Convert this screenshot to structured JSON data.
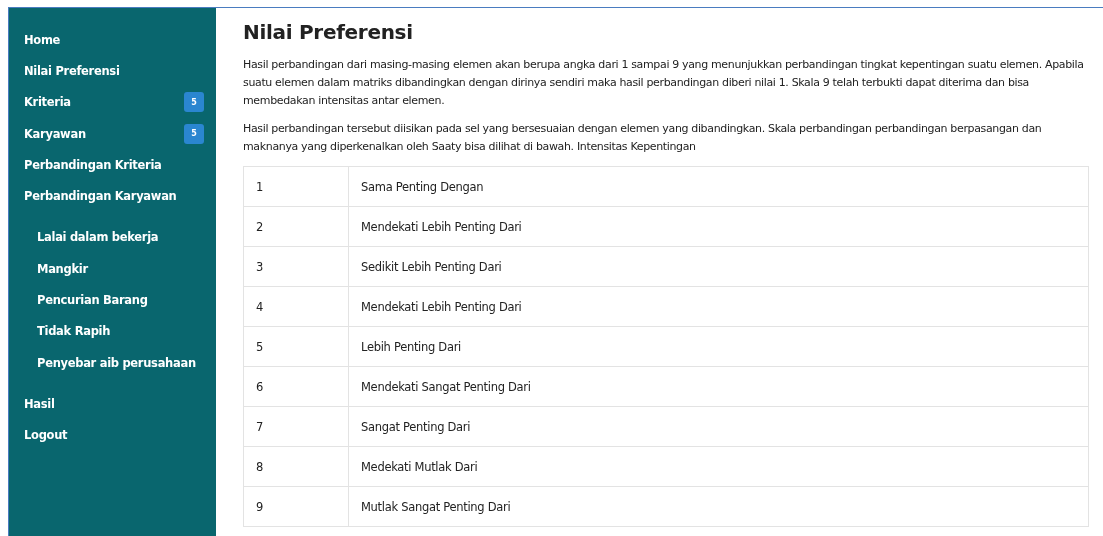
{
  "sidebar": {
    "items": [
      {
        "label": "Home"
      },
      {
        "label": "Nilai Preferensi"
      },
      {
        "label": "Kriteria",
        "badge": "5"
      },
      {
        "label": "Karyawan",
        "badge": "5"
      },
      {
        "label": "Perbandingan Kriteria"
      },
      {
        "label": "Perbandingan Karyawan",
        "children": [
          {
            "label": "Lalai dalam bekerja"
          },
          {
            "label": "Mangkir"
          },
          {
            "label": "Pencurian Barang"
          },
          {
            "label": "Tidak Rapih"
          },
          {
            "label": "Penyebar aib perusahaan"
          }
        ]
      },
      {
        "label": "Hasil"
      },
      {
        "label": "Logout"
      }
    ]
  },
  "main": {
    "title": "Nilai Preferensi",
    "paragraphs": [
      "Hasil perbandingan dari masing-masing elemen akan berupa angka dari 1 sampai 9 yang menunjukkan perbandingan tingkat kepentingan suatu elemen. Apabila suatu elemen dalam matriks dibandingkan dengan dirinya sendiri maka hasil perbandingan diberi nilai 1. Skala 9 telah terbukti dapat diterima dan bisa membedakan intensitas antar elemen.",
      "Hasil perbandingan tersebut diisikan pada sel yang bersesuaian dengan elemen yang dibandingkan. Skala perbandingan perbandingan berpasangan dan maknanya yang diperkenalkan oleh Saaty bisa dilihat di bawah. Intensitas Kepentingan"
    ],
    "table": {
      "rows": [
        [
          "1",
          "Sama Penting Dengan"
        ],
        [
          "2",
          "Mendekati Lebih Penting Dari"
        ],
        [
          "3",
          "Sedikit Lebih Penting Dari"
        ],
        [
          "4",
          "Mendekati Lebih Penting Dari"
        ],
        [
          "5",
          "Lebih Penting Dari"
        ],
        [
          "6",
          "Mendekati Sangat Penting Dari"
        ],
        [
          "7",
          "Sangat Penting Dari"
        ],
        [
          "8",
          "Medekati Mutlak Dari"
        ],
        [
          "9",
          "Mutlak Sangat Penting Dari"
        ]
      ]
    }
  }
}
